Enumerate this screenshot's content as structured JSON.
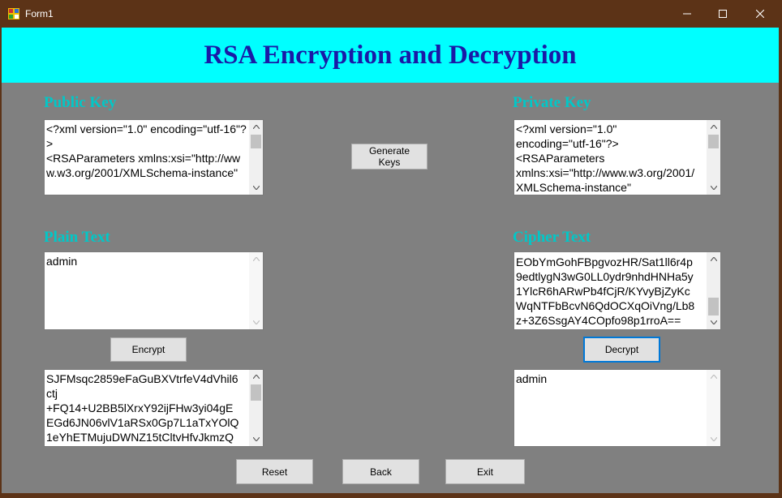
{
  "window": {
    "title": "Form1"
  },
  "banner": {
    "title": "RSA Encryption and Decryption"
  },
  "public_key": {
    "label": "Public Key",
    "value": "<?xml version=\"1.0\" encoding=\"utf-16\"?>\n<RSAParameters xmlns:xsi=\"http://www.w3.org/2001/XMLSchema-instance\""
  },
  "private_key": {
    "label": "Private Key",
    "value": "<?xml version=\"1.0\"\nencoding=\"utf-16\"?>\n<RSAParameters\nxmlns:xsi=\"http://www.w3.org/2001/\nXMLSchema-instance\""
  },
  "generate_button": "Generate Keys",
  "plain_text": {
    "label": "Plain Text",
    "value": "admin"
  },
  "cipher_text": {
    "label": "Cipher Text",
    "value": "EObYmGohFBpgvozHR/Sat1ll6r4p\n9edtlygN3wG0LL0ydr9nhdHNHa5y\n1YlcR6hARwPb4fCjR/KYvyBjZyKc\nWqNTFbBcvN6QdOCXqOiVng/Lb8\nz+3Z6SsgAY4COpfo98p1rroA=="
  },
  "encrypt_button": "Encrypt",
  "decrypt_button": "Decrypt",
  "encrypted_output": {
    "value": "SJFMsqc2859eFaGuBXVtrfeV4dVhil6\nctj\n+FQ14+U2BB5lXrxY92ijFHw3yi04gE\nEGd6JN06vlV1aRSx0Gp7L1aTxYOlQ\n1eYhETMujuDWNZ15tCltvHfvJkmzQ"
  },
  "decrypted_output": {
    "value": "admin"
  },
  "bottom_buttons": {
    "reset": "Reset",
    "back": "Back",
    "exit": "Exit"
  },
  "colors": {
    "banner": "#00ffff",
    "title": "#1a1aa6",
    "labels": "#00c8c8",
    "background": "#808080",
    "titlebar": "#5c3317"
  }
}
